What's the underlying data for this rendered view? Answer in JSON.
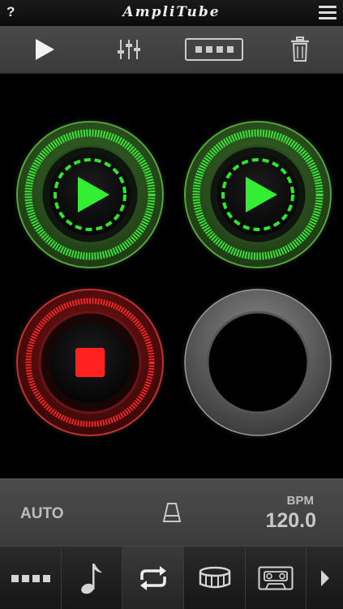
{
  "app": {
    "title": "AmpliTube",
    "help_label": "?"
  },
  "toolbar": {
    "buttons": [
      {
        "name": "play-icon"
      },
      {
        "name": "mixer-sliders-icon"
      },
      {
        "name": "track-view-icon"
      },
      {
        "name": "trash-icon"
      }
    ]
  },
  "pads": [
    {
      "state": "playing",
      "color": "#3ef03e",
      "icon": "play-icon"
    },
    {
      "state": "playing",
      "color": "#3ef03e",
      "icon": "play-icon"
    },
    {
      "state": "recording",
      "color": "#ff2a2a",
      "icon": "stop-icon"
    },
    {
      "state": "empty",
      "color": "#777777",
      "icon": ""
    }
  ],
  "status": {
    "auto_label": "AUTO",
    "bpm_label": "BPM",
    "bpm_value": "120.0"
  },
  "nav": {
    "items": [
      {
        "name": "track-grid-icon"
      },
      {
        "name": "music-note-icon"
      },
      {
        "name": "loop-icon"
      },
      {
        "name": "drum-icon"
      },
      {
        "name": "cassette-icon"
      },
      {
        "name": "chevron-right-icon"
      }
    ]
  },
  "colors": {
    "accent_green": "#3ef03e",
    "accent_red": "#ff2a2a"
  }
}
